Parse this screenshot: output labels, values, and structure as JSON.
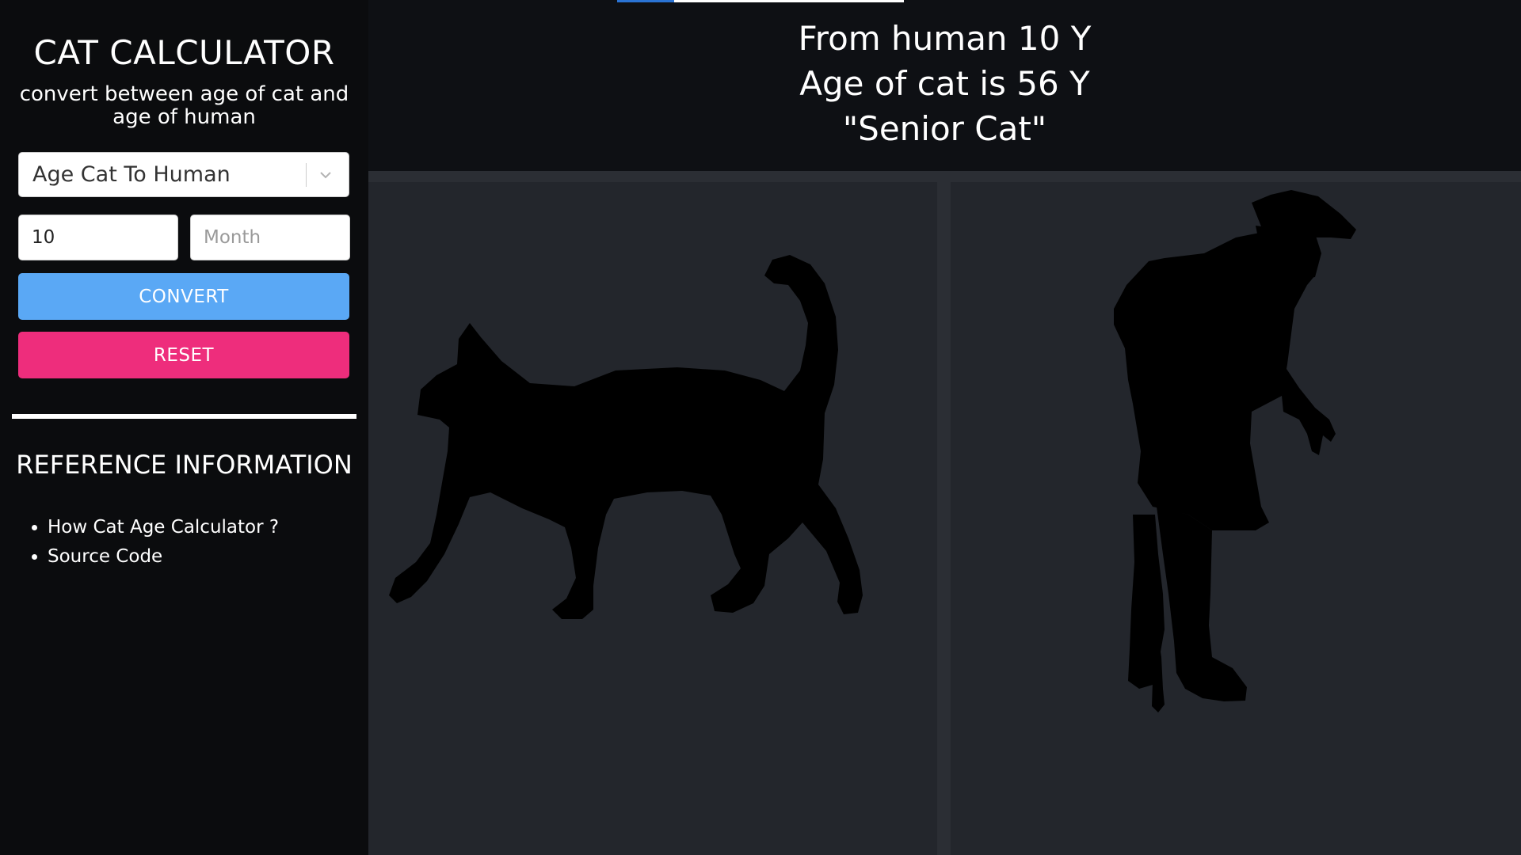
{
  "sidebar": {
    "title": "CAT CALCULATOR",
    "subtitle": "convert between age of cat and age of human",
    "mode_select": {
      "value": "Age Cat To Human",
      "icon": "chevron-down-icon"
    },
    "years_input": {
      "value": "10",
      "placeholder": ""
    },
    "months_input": {
      "value": "",
      "placeholder": "Month"
    },
    "convert_label": "CONVERT",
    "reset_label": "RESET",
    "reference": {
      "title": "REFERENCE INFORMATION",
      "links": [
        {
          "label": "How Cat Age Calculator ?"
        },
        {
          "label": "Source Code"
        }
      ]
    }
  },
  "main": {
    "progress": {
      "fraction": 0.2
    },
    "result": {
      "line1": "From human 10 Y",
      "line2": "Age of cat is 56 Y",
      "line3": "\"Senior Cat\""
    },
    "images": {
      "cat": "cat-silhouette",
      "human": "elderly-human-with-cane-silhouette"
    }
  },
  "colors": {
    "sidebar_bg": "#0b0c0e",
    "main_bg": "#0e1014",
    "panel_bg": "#23262c",
    "convert_button": "#5aa8f5",
    "reset_button": "#ee2d7c",
    "progress_fill": "#2a73d4"
  }
}
